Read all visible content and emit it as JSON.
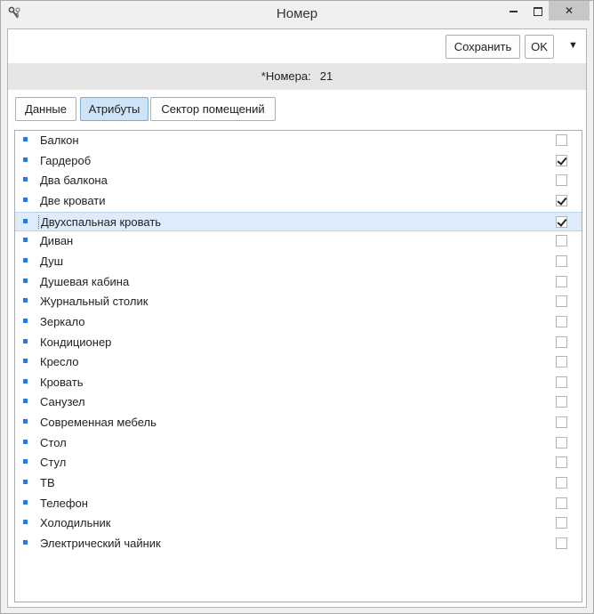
{
  "window": {
    "title": "Номер",
    "minimize_label": "",
    "maximize_label": "",
    "close_label": "✕"
  },
  "toolbar": {
    "save_label": "Сохранить",
    "ok_label": "OK",
    "menu_icon": "▼"
  },
  "header": {
    "label": "*Номера:",
    "value": "21"
  },
  "tabs": [
    {
      "label": "Данные",
      "active": false
    },
    {
      "label": "Атрибуты",
      "active": true
    },
    {
      "label": "Сектор помещений",
      "active": false
    }
  ],
  "attributes": [
    {
      "label": "Балкон",
      "checked": false
    },
    {
      "label": "Гардероб",
      "checked": true
    },
    {
      "label": "Два балкона",
      "checked": false
    },
    {
      "label": "Две кровати",
      "checked": true
    },
    {
      "label": "Двухспальная кровать",
      "checked": true,
      "selected": true
    },
    {
      "label": "Диван",
      "checked": false
    },
    {
      "label": "Душ",
      "checked": false
    },
    {
      "label": "Душевая кабина",
      "checked": false
    },
    {
      "label": "Журнальный столик",
      "checked": false
    },
    {
      "label": "Зеркало",
      "checked": false
    },
    {
      "label": "Кондиционер",
      "checked": false
    },
    {
      "label": "Кресло",
      "checked": false
    },
    {
      "label": "Кровать",
      "checked": false
    },
    {
      "label": "Санузел",
      "checked": false
    },
    {
      "label": "Современная мебель",
      "checked": false
    },
    {
      "label": "Стол",
      "checked": false
    },
    {
      "label": "Стул",
      "checked": false
    },
    {
      "label": "ТВ",
      "checked": false
    },
    {
      "label": "Телефон",
      "checked": false
    },
    {
      "label": "Холодильник",
      "checked": false
    },
    {
      "label": "Электрический чайник",
      "checked": false
    }
  ],
  "colors": {
    "accent": "#2a7bd3",
    "selected_row": "#ddebfa",
    "active_tab": "#cde3f7"
  }
}
